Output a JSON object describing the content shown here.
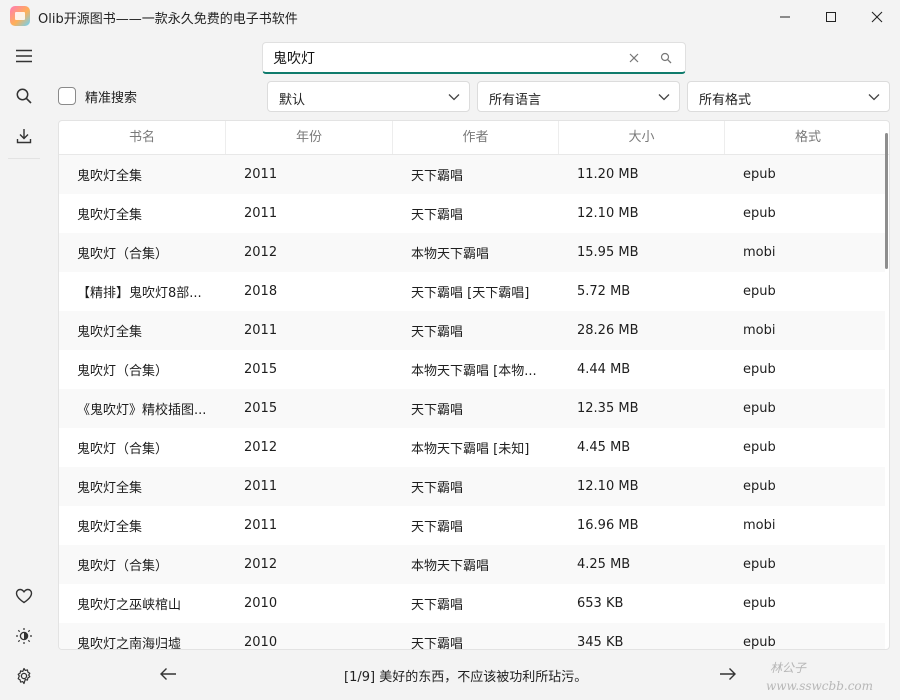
{
  "window": {
    "title": "Olib开源图书——一款永久免费的电子书软件"
  },
  "sidebar": {
    "top": [
      {
        "icon": "hamburger-menu-icon"
      },
      {
        "icon": "search-icon"
      },
      {
        "icon": "download-icon"
      }
    ],
    "bottom": [
      {
        "icon": "heart-icon"
      },
      {
        "icon": "theme-brightness-icon"
      },
      {
        "icon": "gear-icon"
      }
    ]
  },
  "search": {
    "value": "鬼吹灯",
    "placeholder": ""
  },
  "filters": {
    "exact_search_label": "精准搜索",
    "exact_search_checked": false,
    "sort_selected": "默认",
    "language_selected": "所有语言",
    "format_selected": "所有格式"
  },
  "table": {
    "columns": [
      "书名",
      "年份",
      "作者",
      "大小",
      "格式"
    ],
    "rows": [
      [
        "鬼吹灯全集",
        "2011",
        "天下霸唱",
        "11.20 MB",
        "epub"
      ],
      [
        "鬼吹灯全集",
        "2011",
        "天下霸唱",
        "12.10 MB",
        "epub"
      ],
      [
        "鬼吹灯（合集）",
        "2012",
        "本物天下霸唱",
        "15.95 MB",
        "mobi"
      ],
      [
        "【精排】鬼吹灯8部...",
        "2018",
        "天下霸唱 [天下霸唱]",
        "5.72 MB",
        "epub"
      ],
      [
        "鬼吹灯全集",
        "2011",
        "天下霸唱",
        "28.26 MB",
        "mobi"
      ],
      [
        "鬼吹灯（合集）",
        "2015",
        "本物天下霸唱 [本物...",
        "4.44 MB",
        "epub"
      ],
      [
        "《鬼吹灯》精校插图...",
        "2015",
        "天下霸唱",
        "12.35 MB",
        "epub"
      ],
      [
        "鬼吹灯（合集）",
        "2012",
        "本物天下霸唱 [未知]",
        "4.45 MB",
        "epub"
      ],
      [
        "鬼吹灯全集",
        "2011",
        "天下霸唱",
        "12.10 MB",
        "epub"
      ],
      [
        "鬼吹灯全集",
        "2011",
        "天下霸唱",
        "16.96 MB",
        "mobi"
      ],
      [
        "鬼吹灯（合集）",
        "2012",
        "本物天下霸唱",
        "4.25 MB",
        "epub"
      ],
      [
        "鬼吹灯之巫峡棺山",
        "2010",
        "天下霸唱",
        "653 KB",
        "epub"
      ],
      [
        "鬼吹灯之南海归墟",
        "2010",
        "天下霸唱",
        "345 KB",
        "epub"
      ]
    ]
  },
  "pager": {
    "text": "[1/9] 美好的东西，不应该被功利所玷污。"
  },
  "watermark": {
    "line1": "林公子",
    "line2": "www.sswcbb.com"
  },
  "colors": {
    "accent": "#0f7b6c"
  }
}
